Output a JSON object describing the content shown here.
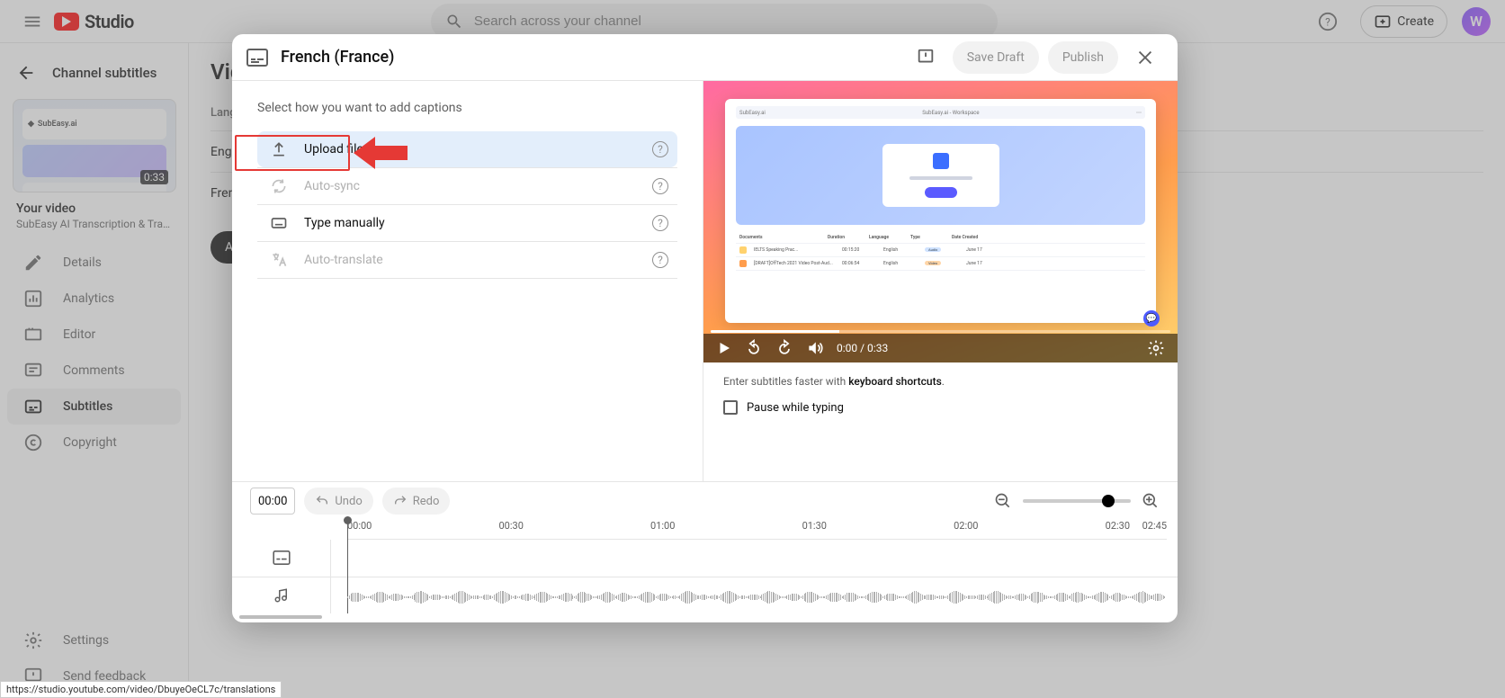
{
  "header": {
    "logo_text": "Studio",
    "search_placeholder": "Search across your channel",
    "create_label": "Create",
    "avatar_initial": "W"
  },
  "sidebar": {
    "back_label": "Channel subtitles",
    "thumb_duration": "0:33",
    "thumb_logo": "SubEasy.ai",
    "video_heading": "Your video",
    "video_title": "SubEasy AI Transcription & Translati...",
    "nav": {
      "details": "Details",
      "analytics": "Analytics",
      "editor": "Editor",
      "comments": "Comments",
      "subtitles": "Subtitles",
      "copyright": "Copyright",
      "settings": "Settings",
      "feedback": "Send feedback"
    }
  },
  "main_bg": {
    "title_partial": "Vid",
    "lang_header": "Language",
    "lang1": "English",
    "lang2": "French",
    "add_label": "Add"
  },
  "dialog": {
    "title": "French (France)",
    "save": "Save Draft",
    "publish": "Publish",
    "prompt": "Select how you want to add captions",
    "opts": {
      "upload": "Upload file",
      "autosync": "Auto-sync",
      "type": "Type manually",
      "autotrans": "Auto-translate"
    },
    "hint_prefix": "Enter subtitles faster with ",
    "hint_bold": "keyboard shortcuts",
    "hint_suffix": ".",
    "pause": "Pause while typing",
    "video": {
      "topbar": "SubEasy.ai - Workspace",
      "brand": "SubEasy.ai",
      "docs_header": "Documents",
      "row1": "IELTS Speaking Prac...",
      "row2": "[DRAFT]OffTech 2021 Video Post-Aud...",
      "time": "0:00 / 0:33"
    },
    "timeline": {
      "time": "00:00",
      "undo": "Undo",
      "redo": "Redo",
      "ticks": [
        "00:00",
        "00:30",
        "01:00",
        "01:30",
        "02:00",
        "02:30",
        "02:45"
      ]
    }
  },
  "status_url": "https://studio.youtube.com/video/DbuyeOeCL7c/translations"
}
